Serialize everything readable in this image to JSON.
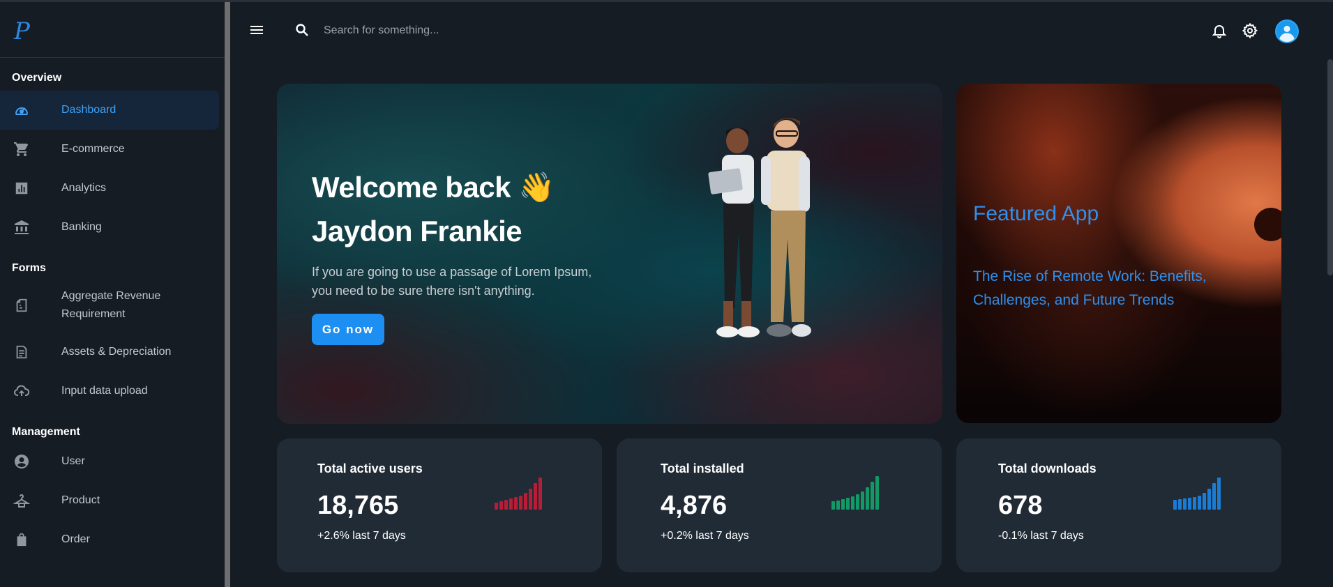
{
  "brand": {
    "logo_letter": "P"
  },
  "sidebar": {
    "sections": [
      {
        "title": "Overview",
        "items": [
          {
            "label": "Dashboard",
            "icon": "gauge-icon",
            "active": true
          },
          {
            "label": "E-commerce",
            "icon": "cart-icon"
          },
          {
            "label": "Analytics",
            "icon": "chart-icon"
          },
          {
            "label": "Banking",
            "icon": "bank-icon"
          }
        ]
      },
      {
        "title": "Forms",
        "items": [
          {
            "label": "Aggregate Revenue Requirement",
            "icon": "doc-fold-icon"
          },
          {
            "label": "Assets & Depreciation",
            "icon": "document-icon"
          },
          {
            "label": "Input data upload",
            "icon": "cloud-upload-icon"
          }
        ]
      },
      {
        "title": "Management",
        "items": [
          {
            "label": "User",
            "icon": "user-circle-icon"
          },
          {
            "label": "Product",
            "icon": "hanger-icon"
          },
          {
            "label": "Order",
            "icon": "bag-icon"
          }
        ]
      }
    ]
  },
  "topbar": {
    "search_placeholder": "Search for something...",
    "icons": [
      "menu-icon",
      "search-icon",
      "bell-icon",
      "gear-icon",
      "avatar"
    ]
  },
  "hero": {
    "greeting": "Welcome back 👋",
    "name": "Jaydon Frankie",
    "description": "If you are going to use a passage of Lorem Ipsum, you need to be sure there isn't anything.",
    "button_label": "Go now"
  },
  "featured": {
    "label": "Featured App",
    "title": "The Rise of Remote Work: Benefits, Challenges, and Future Trends"
  },
  "stats": [
    {
      "title": "Total active users",
      "value": "18,765",
      "change": "+2.6% last 7 days",
      "color": "#b71d36",
      "bars": [
        10,
        12,
        14,
        16,
        18,
        20,
        24,
        30,
        38,
        46
      ]
    },
    {
      "title": "Total installed",
      "value": "4,876",
      "change": "+0.2% last 7 days",
      "color": "#119a66",
      "bars": [
        12,
        13,
        15,
        17,
        19,
        22,
        26,
        32,
        40,
        48
      ]
    },
    {
      "title": "Total downloads",
      "value": "678",
      "change": "-0.1% last 7 days",
      "color": "#1b7cd4",
      "bars": [
        14,
        15,
        16,
        17,
        18,
        20,
        24,
        30,
        38,
        46
      ]
    }
  ],
  "colors": {
    "accent": "#1e8ff2",
    "sidebar_active_bg": "#15263a",
    "card_bg": "#212b36",
    "page_bg": "#161c24"
  }
}
